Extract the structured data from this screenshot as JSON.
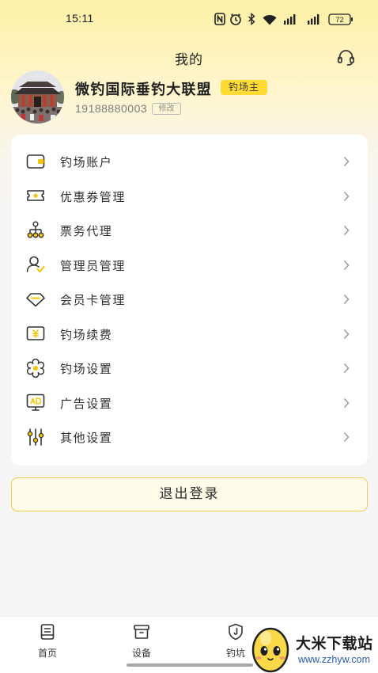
{
  "status_bar": {
    "time": "15:11",
    "battery_level": "72",
    "icons": [
      "nfc-icon",
      "alarm-icon",
      "bluetooth-icon",
      "wifi-icon",
      "signal-icon",
      "signal-icon",
      "battery-icon"
    ]
  },
  "header": {
    "title": "我的",
    "service_icon": "headset-icon"
  },
  "profile": {
    "name": "微钓国际垂钓大联盟",
    "role_badge": "钓场主",
    "phone": "19188880003",
    "edit_label": "修改"
  },
  "menu": {
    "items": [
      {
        "label": "钓场账户",
        "icon": "wallet-icon"
      },
      {
        "label": "优惠券管理",
        "icon": "coupon-icon"
      },
      {
        "label": "票务代理",
        "icon": "network-icon"
      },
      {
        "label": "管理员管理",
        "icon": "admin-user-icon"
      },
      {
        "label": "会员卡管理",
        "icon": "diamond-icon"
      },
      {
        "label": "钓场续费",
        "icon": "yen-card-icon"
      },
      {
        "label": "钓场设置",
        "icon": "gear-icon"
      },
      {
        "label": "广告设置",
        "icon": "ad-monitor-icon"
      },
      {
        "label": "其他设置",
        "icon": "sliders-icon"
      }
    ]
  },
  "logout": {
    "label": "退出登录"
  },
  "tabbar": {
    "items": [
      {
        "label": "首页",
        "icon": "receipt-icon"
      },
      {
        "label": "设备",
        "icon": "box-icon"
      },
      {
        "label": "钓坑",
        "icon": "shield-icon"
      }
    ]
  },
  "watermark": {
    "title": "大米下载站",
    "url": "www.zzhyw.com"
  },
  "colors": {
    "accent": "#FFDB34",
    "icon_accent": "#F5C400",
    "logout_border": "#EDCC4E",
    "logout_background": "#FFFBE8",
    "page_background": "#F5F5F5",
    "text": "#333333"
  }
}
